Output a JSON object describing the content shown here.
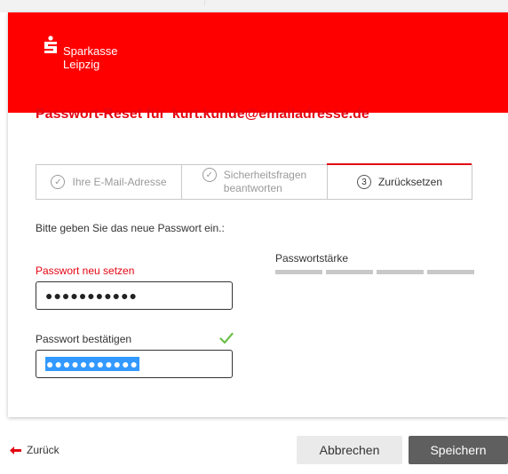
{
  "brand": {
    "line1": "Sparkasse",
    "line2": "Leipzig"
  },
  "title": {
    "prefix": "Passwort-Reset für",
    "email": "kurt.kunde@emailadresse.de"
  },
  "steps": [
    {
      "number": "✓",
      "label": "Ihre E-Mail-Adresse",
      "state": "done"
    },
    {
      "number": "✓",
      "label_line1": "Sicherheitsfragen",
      "label_line2": "beantworten",
      "state": "done"
    },
    {
      "number": "3",
      "label": "Zurücksetzen",
      "state": "active"
    }
  ],
  "instruction": "Bitte geben Sie das neue Passwort ein.:",
  "new_password": {
    "label": "Passwort neu setzen",
    "value": "●●●●●●●●●●●"
  },
  "confirm_password": {
    "label": "Passwort bestätigen",
    "value": "●●●●●●●●●●●"
  },
  "strength": {
    "label": "Passwortstärke",
    "segments": 4,
    "filled": 0
  },
  "footer": {
    "back": "Zurück",
    "cancel": "Abbrechen",
    "save": "Speichern"
  },
  "colors": {
    "brand_red": "#ff0000",
    "title_red": "#e30613",
    "check_green": "#6cc04a",
    "save_bg": "#5f5f5f"
  }
}
